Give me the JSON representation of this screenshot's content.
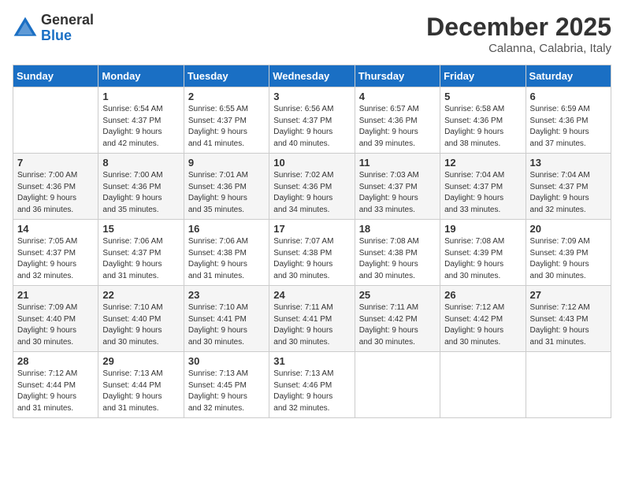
{
  "logo": {
    "general": "General",
    "blue": "Blue"
  },
  "title": "December 2025",
  "location": "Calanna, Calabria, Italy",
  "weekdays": [
    "Sunday",
    "Monday",
    "Tuesday",
    "Wednesday",
    "Thursday",
    "Friday",
    "Saturday"
  ],
  "weeks": [
    [
      {
        "day": "",
        "info": ""
      },
      {
        "day": "1",
        "info": "Sunrise: 6:54 AM\nSunset: 4:37 PM\nDaylight: 9 hours\nand 42 minutes."
      },
      {
        "day": "2",
        "info": "Sunrise: 6:55 AM\nSunset: 4:37 PM\nDaylight: 9 hours\nand 41 minutes."
      },
      {
        "day": "3",
        "info": "Sunrise: 6:56 AM\nSunset: 4:37 PM\nDaylight: 9 hours\nand 40 minutes."
      },
      {
        "day": "4",
        "info": "Sunrise: 6:57 AM\nSunset: 4:36 PM\nDaylight: 9 hours\nand 39 minutes."
      },
      {
        "day": "5",
        "info": "Sunrise: 6:58 AM\nSunset: 4:36 PM\nDaylight: 9 hours\nand 38 minutes."
      },
      {
        "day": "6",
        "info": "Sunrise: 6:59 AM\nSunset: 4:36 PM\nDaylight: 9 hours\nand 37 minutes."
      }
    ],
    [
      {
        "day": "7",
        "info": "Sunrise: 7:00 AM\nSunset: 4:36 PM\nDaylight: 9 hours\nand 36 minutes."
      },
      {
        "day": "8",
        "info": "Sunrise: 7:00 AM\nSunset: 4:36 PM\nDaylight: 9 hours\nand 35 minutes."
      },
      {
        "day": "9",
        "info": "Sunrise: 7:01 AM\nSunset: 4:36 PM\nDaylight: 9 hours\nand 35 minutes."
      },
      {
        "day": "10",
        "info": "Sunrise: 7:02 AM\nSunset: 4:36 PM\nDaylight: 9 hours\nand 34 minutes."
      },
      {
        "day": "11",
        "info": "Sunrise: 7:03 AM\nSunset: 4:37 PM\nDaylight: 9 hours\nand 33 minutes."
      },
      {
        "day": "12",
        "info": "Sunrise: 7:04 AM\nSunset: 4:37 PM\nDaylight: 9 hours\nand 33 minutes."
      },
      {
        "day": "13",
        "info": "Sunrise: 7:04 AM\nSunset: 4:37 PM\nDaylight: 9 hours\nand 32 minutes."
      }
    ],
    [
      {
        "day": "14",
        "info": "Sunrise: 7:05 AM\nSunset: 4:37 PM\nDaylight: 9 hours\nand 32 minutes."
      },
      {
        "day": "15",
        "info": "Sunrise: 7:06 AM\nSunset: 4:37 PM\nDaylight: 9 hours\nand 31 minutes."
      },
      {
        "day": "16",
        "info": "Sunrise: 7:06 AM\nSunset: 4:38 PM\nDaylight: 9 hours\nand 31 minutes."
      },
      {
        "day": "17",
        "info": "Sunrise: 7:07 AM\nSunset: 4:38 PM\nDaylight: 9 hours\nand 30 minutes."
      },
      {
        "day": "18",
        "info": "Sunrise: 7:08 AM\nSunset: 4:38 PM\nDaylight: 9 hours\nand 30 minutes."
      },
      {
        "day": "19",
        "info": "Sunrise: 7:08 AM\nSunset: 4:39 PM\nDaylight: 9 hours\nand 30 minutes."
      },
      {
        "day": "20",
        "info": "Sunrise: 7:09 AM\nSunset: 4:39 PM\nDaylight: 9 hours\nand 30 minutes."
      }
    ],
    [
      {
        "day": "21",
        "info": "Sunrise: 7:09 AM\nSunset: 4:40 PM\nDaylight: 9 hours\nand 30 minutes."
      },
      {
        "day": "22",
        "info": "Sunrise: 7:10 AM\nSunset: 4:40 PM\nDaylight: 9 hours\nand 30 minutes."
      },
      {
        "day": "23",
        "info": "Sunrise: 7:10 AM\nSunset: 4:41 PM\nDaylight: 9 hours\nand 30 minutes."
      },
      {
        "day": "24",
        "info": "Sunrise: 7:11 AM\nSunset: 4:41 PM\nDaylight: 9 hours\nand 30 minutes."
      },
      {
        "day": "25",
        "info": "Sunrise: 7:11 AM\nSunset: 4:42 PM\nDaylight: 9 hours\nand 30 minutes."
      },
      {
        "day": "26",
        "info": "Sunrise: 7:12 AM\nSunset: 4:42 PM\nDaylight: 9 hours\nand 30 minutes."
      },
      {
        "day": "27",
        "info": "Sunrise: 7:12 AM\nSunset: 4:43 PM\nDaylight: 9 hours\nand 31 minutes."
      }
    ],
    [
      {
        "day": "28",
        "info": "Sunrise: 7:12 AM\nSunset: 4:44 PM\nDaylight: 9 hours\nand 31 minutes."
      },
      {
        "day": "29",
        "info": "Sunrise: 7:13 AM\nSunset: 4:44 PM\nDaylight: 9 hours\nand 31 minutes."
      },
      {
        "day": "30",
        "info": "Sunrise: 7:13 AM\nSunset: 4:45 PM\nDaylight: 9 hours\nand 32 minutes."
      },
      {
        "day": "31",
        "info": "Sunrise: 7:13 AM\nSunset: 4:46 PM\nDaylight: 9 hours\nand 32 minutes."
      },
      {
        "day": "",
        "info": ""
      },
      {
        "day": "",
        "info": ""
      },
      {
        "day": "",
        "info": ""
      }
    ]
  ]
}
